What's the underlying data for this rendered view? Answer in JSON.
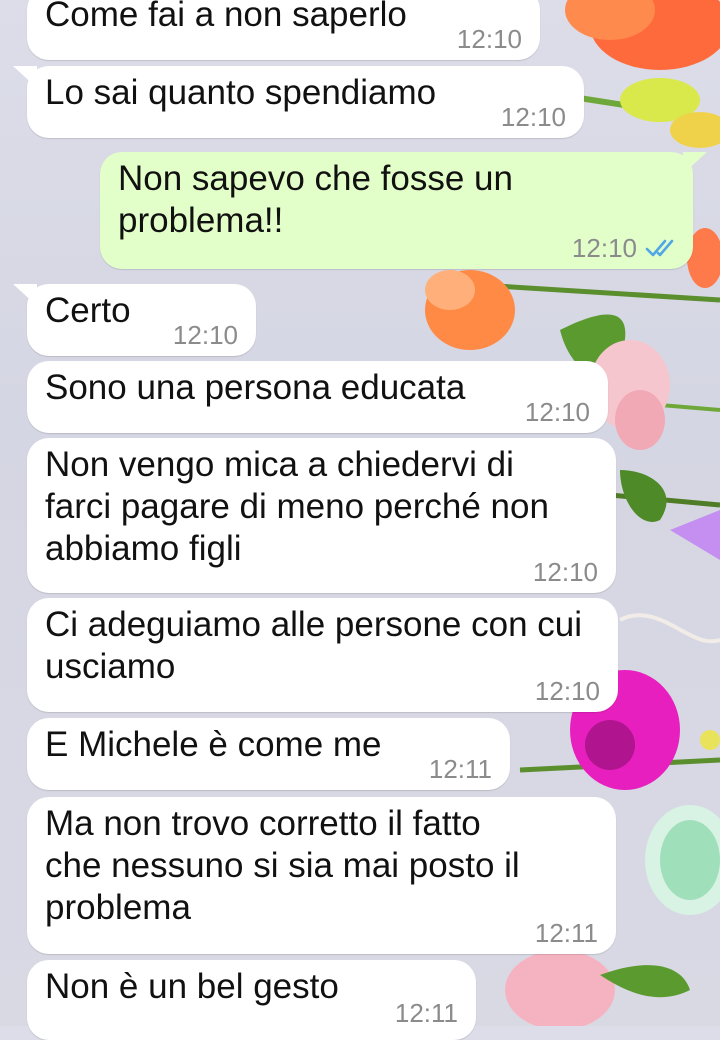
{
  "colors": {
    "incoming_bubble": "#ffffff",
    "outgoing_bubble": "#e2fec9",
    "read_ticks": "#4fa7e8",
    "timestamp": "#8b8b8b"
  },
  "messages": [
    {
      "direction": "in",
      "text": "Come fai a non saperlo",
      "time": "12:10"
    },
    {
      "direction": "in",
      "text": "Lo sai quanto spendiamo",
      "time": "12:10"
    },
    {
      "direction": "out",
      "text": "Non sapevo che fosse un\nproblema!!",
      "time": "12:10",
      "status_icon": "double-check-read-icon"
    },
    {
      "direction": "in",
      "text": "Certo",
      "time": "12:10"
    },
    {
      "direction": "in",
      "text": "Sono una persona educata",
      "time": "12:10"
    },
    {
      "direction": "in",
      "text": "Non vengo mica a chiedervi di\nfarci pagare di meno perché non\nabbiamo figli",
      "time": "12:10"
    },
    {
      "direction": "in",
      "text": "Ci adeguiamo alle persone con cui\nusciamo",
      "time": "12:10"
    },
    {
      "direction": "in",
      "text": "E Michele è come me",
      "time": "12:11"
    },
    {
      "direction": "in",
      "text": "Ma non trovo corretto il fatto\nche nessuno si sia mai posto il\nproblema",
      "time": "12:11"
    },
    {
      "direction": "in",
      "text": "Non è un bel gesto",
      "time": "12:11"
    }
  ]
}
